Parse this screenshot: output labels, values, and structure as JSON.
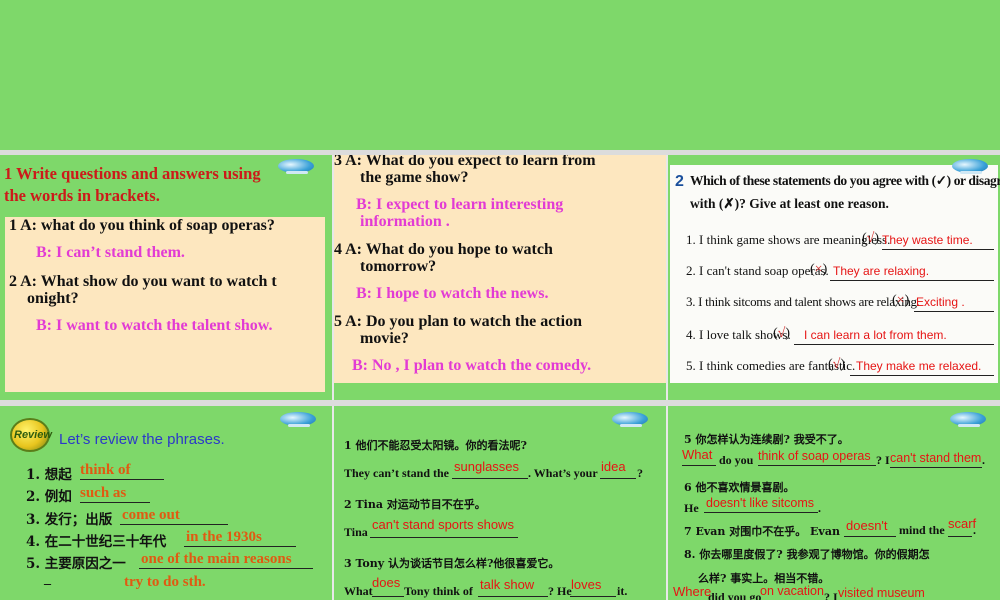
{
  "panel1": {
    "heading": "1  Write questions and answers using the words in brackets.",
    "heading_line1": "1  Write questions and answers using",
    "heading_line2": "the words in brackets.",
    "q1": "1    A: what do you think of soap operas?",
    "a1": "B: I can’t stand them.",
    "q2_line1": "2  A: What show do you want to watch t",
    "q2_line2": "onight?",
    "a2": "B: I want to watch the talent show."
  },
  "panel2": {
    "q3_line1": "3    A: What do you expect to learn from",
    "q3_line2": "the game show?",
    "a3_line1": "B: I expect to learn interesting",
    "a3_line2": "information .",
    "q4_line1": "4    A: What do you hope to watch",
    "q4_line2": "tomorrow?",
    "a4": "B: I hope to watch the news.",
    "q5_line1": "5    A: Do you plan to watch the action",
    "q5_line2": "movie?",
    "a5": "B: No , I plan to watch the comedy."
  },
  "panel3": {
    "title_num": "2",
    "title_line1": "Which of these statements do you agree with (✓) or disagree",
    "title_line2": "with (✗)? Give at least one reason.",
    "items": [
      {
        "text": "1. I think game shows are meaningless.",
        "mark": "√",
        "answer": "They waste time."
      },
      {
        "text": "2. I can't stand soap operas.",
        "mark": "×",
        "answer": "They are relaxing."
      },
      {
        "text": "3. I think sitcoms and talent shows are relaxing.",
        "mark": "×",
        "answer": "Exciting ."
      },
      {
        "text": "4. I love talk shows.",
        "mark": "√",
        "answer": "I can learn a lot from them."
      },
      {
        "text": "5. I think comedies are fantastic.",
        "mark": "√",
        "answer": "They make me relaxed."
      }
    ]
  },
  "panel4": {
    "badge": "Review",
    "title": "Let’s review the phrases.",
    "items": [
      {
        "prompt": "1.  想起",
        "answer": "think of"
      },
      {
        "prompt": "2.  例如",
        "answer": "such as"
      },
      {
        "prompt": "3.  发行；出版",
        "answer": "come out"
      },
      {
        "prompt": "4.  在二十世纪三十年代",
        "answer": "in the 1930s"
      },
      {
        "prompt": "5.  主要原因之一",
        "answer": "one of the main reasons"
      }
    ],
    "extra_answer": "try to do sth.",
    "extra_prompt": "_"
  },
  "panel5": {
    "s1_cn": "1  他们不能忍受太阳镜。你的看法呢?",
    "s1_en_a": "They can’t stand the",
    "s1_ans1": "sunglasses",
    "s1_en_b": ". What’s your",
    "s1_ans2": "idea",
    "s1_en_c": "?",
    "s2_cn": "2 Tina 对运动节目不在乎。",
    "s2_en_a": "Tina",
    "s2_ans": "can't stand sports shows",
    "s3_cn": "3 Tony 认为谈话节目怎么样?他很喜爱它。",
    "s3_en_a": "What",
    "s3_ans1": "does",
    "s3_en_b": "Tony think of",
    "s3_ans2": "talk show",
    "s3_en_c": "? He",
    "s3_ans3": "loves",
    "s3_en_d": "it."
  },
  "panel6": {
    "s5_cn": "5  你怎样认为连续剧? 我受不了。",
    "s5_ans1": "What",
    "s5_en_a": "do you",
    "s5_ans2": "think of soap operas",
    "s5_en_b": "? I",
    "s5_ans3": "can't stand them",
    "s5_en_c": ".",
    "s6_cn": "6 他不喜欢情景喜剧。",
    "s6_en_a": "He",
    "s6_ans": "doesn't like sitcoms",
    "s6_en_b": ".",
    "s7_cn_a": "7 Evan 对围巾不在乎。 Evan",
    "s7_ans1": "doesn't",
    "s7_en_b": "mind the",
    "s7_ans2": "scarf",
    "s7_en_c": ".",
    "s8_cn": "8.  你去哪里度假了? 我参观了博物馆。你的假期怎",
    "s8_cn2": "么样? 事实上。相当不错。",
    "s8_ans1": "Where",
    "s8_en_a": "did you go",
    "s8_ans2": "on vacation",
    "s8_en_b": "?  I",
    "s8_ans3": "visited museum"
  }
}
